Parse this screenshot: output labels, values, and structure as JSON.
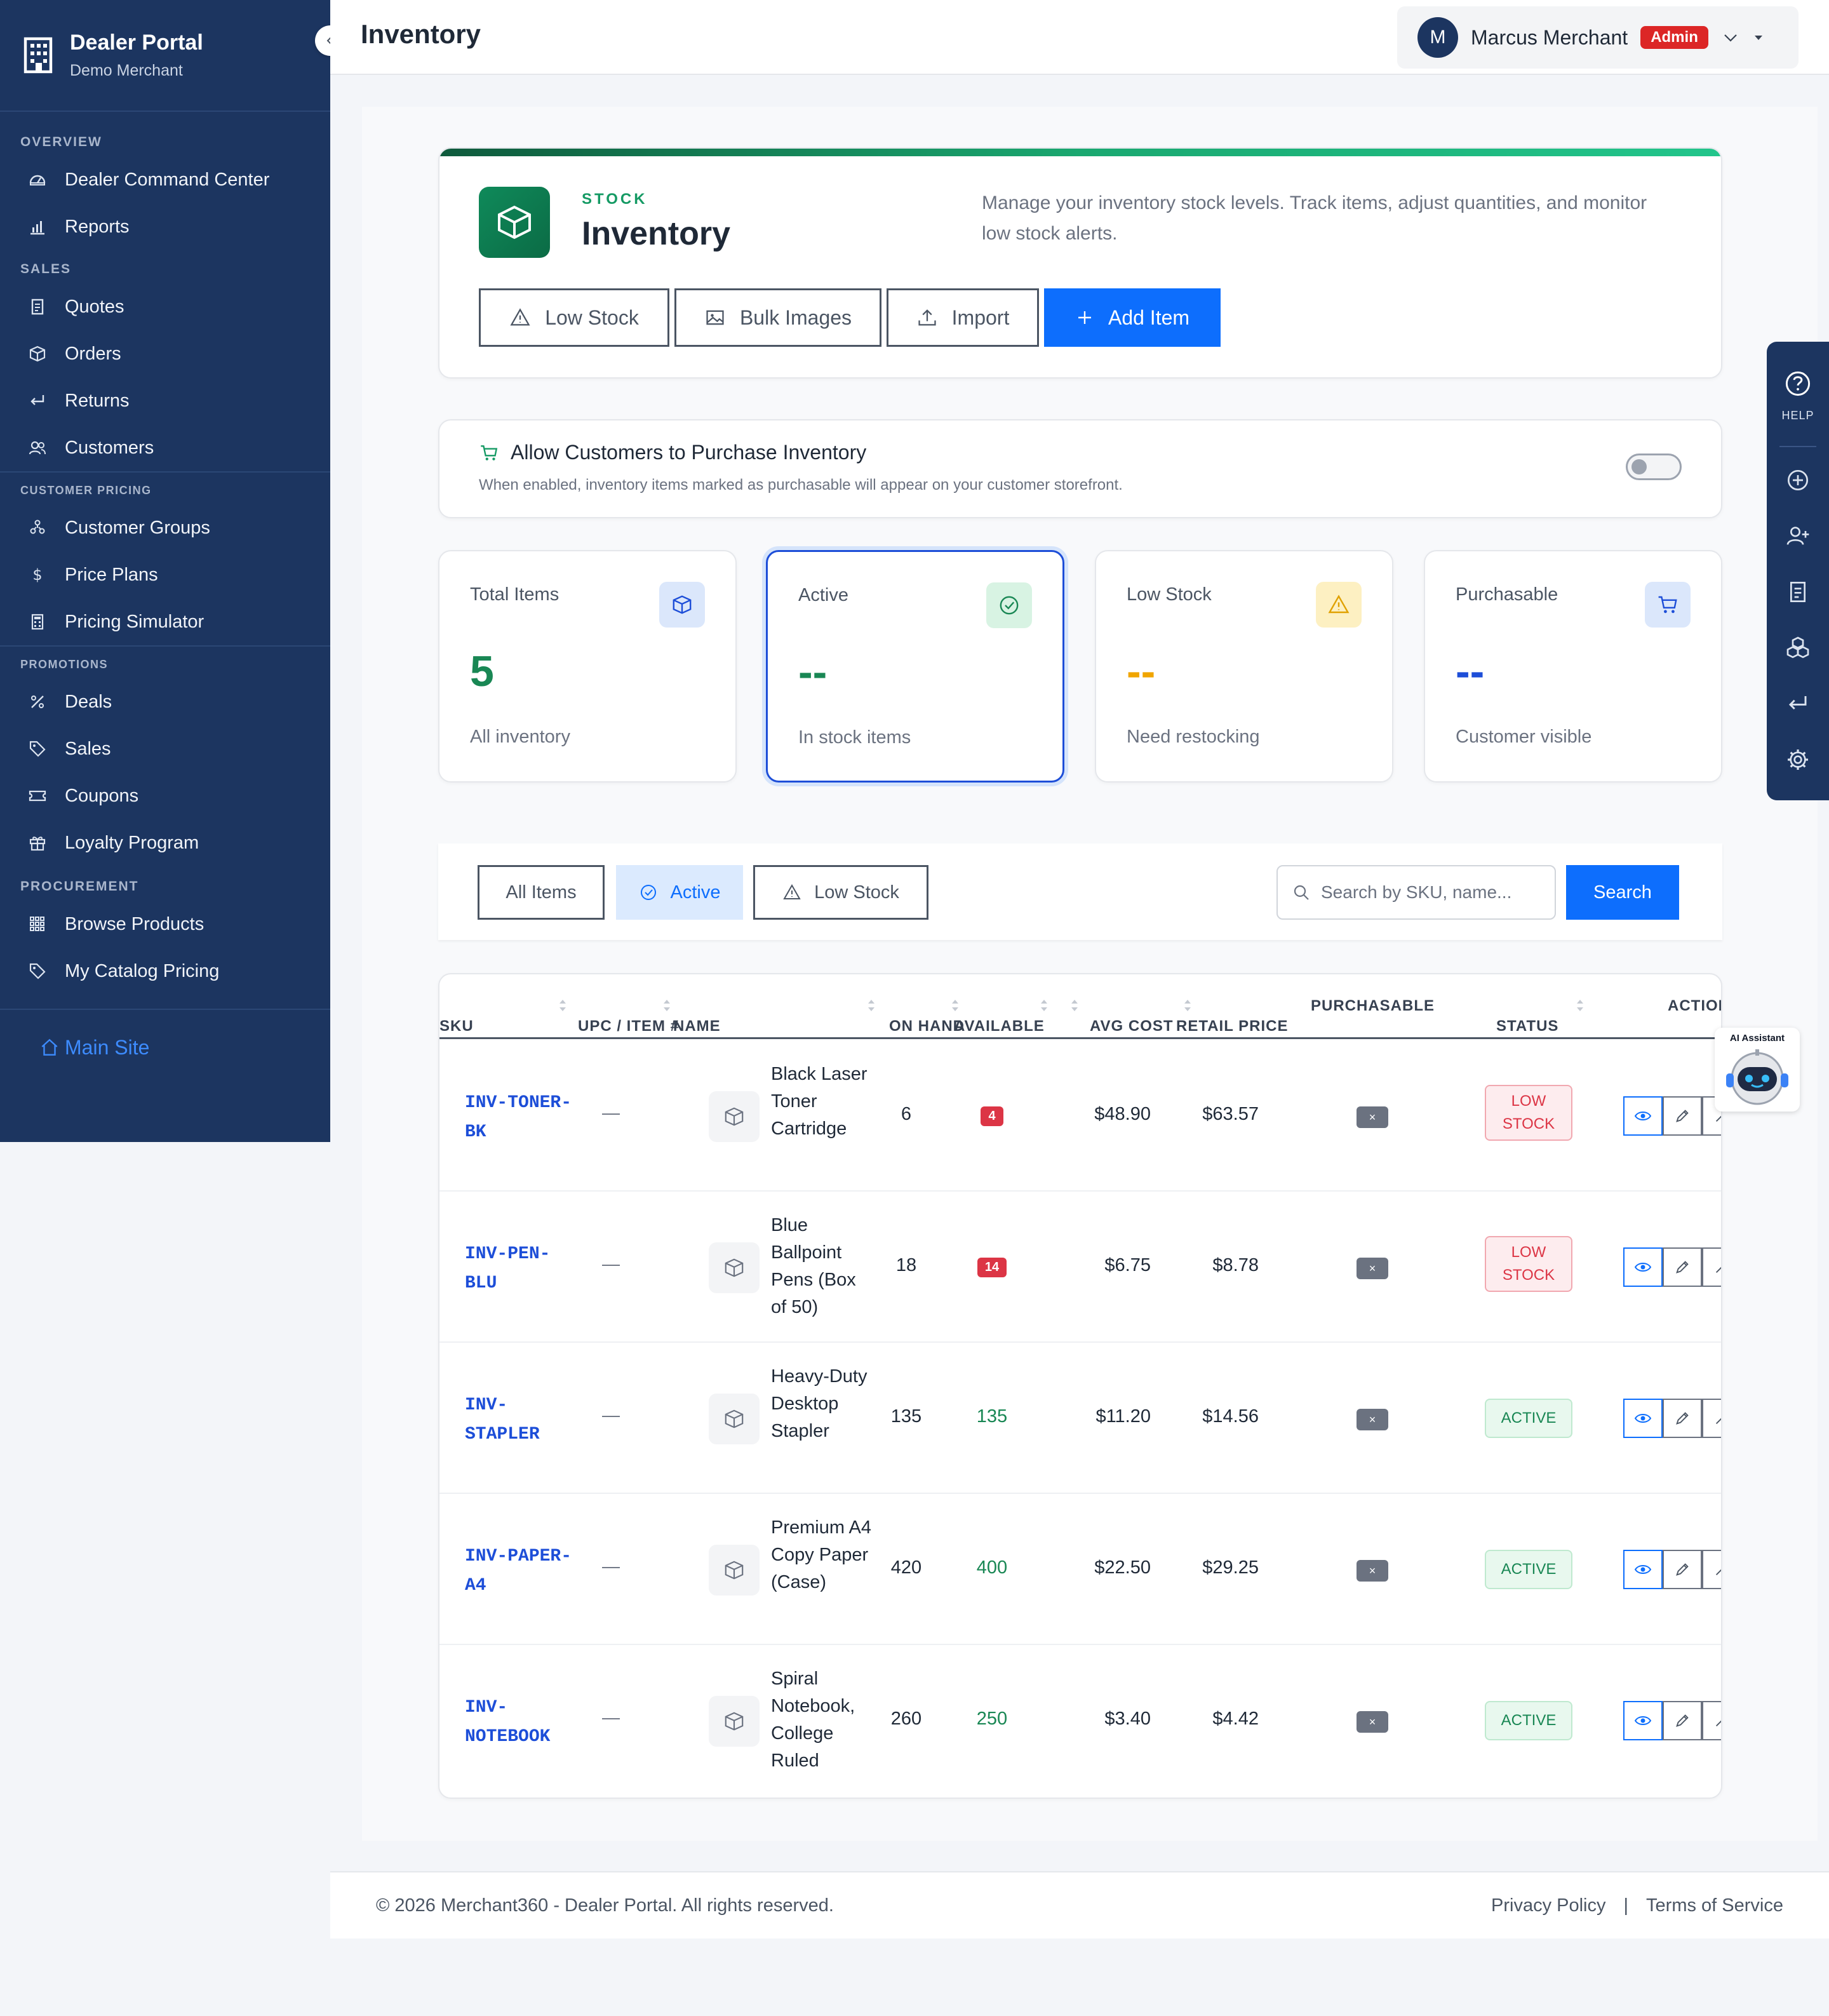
{
  "brand": {
    "title": "Dealer Portal",
    "subtitle": "Demo Merchant"
  },
  "nav": {
    "overview_label": "OVERVIEW",
    "dealer_command_center": "Dealer Command Center",
    "reports": "Reports",
    "sales_label": "SALES",
    "quotes": "Quotes",
    "orders": "Orders",
    "returns": "Returns",
    "customers": "Customers",
    "customer_pricing_label": "CUSTOMER PRICING",
    "customer_groups": "Customer Groups",
    "price_plans": "Price Plans",
    "pricing_simulator": "Pricing Simulator",
    "promotions_label": "PROMOTIONS",
    "deals": "Deals",
    "sales": "Sales",
    "coupons": "Coupons",
    "loyalty_program": "Loyalty Program",
    "procurement_label": "PROCUREMENT",
    "browse_products": "Browse Products",
    "my_catalog_pricing": "My Catalog Pricing",
    "main_site": "Main Site"
  },
  "topbar": {
    "title": "Inventory",
    "user_initial": "M",
    "user_name": "Marcus Merchant",
    "role_badge": "Admin"
  },
  "header": {
    "eyebrow": "STOCK",
    "title": "Inventory",
    "description": "Manage your inventory stock levels. Track items, adjust quantities, and monitor low stock alerts.",
    "buttons": {
      "low_stock": "Low Stock",
      "bulk_images": "Bulk Images",
      "import": "Import",
      "add_item": "Add Item"
    }
  },
  "purchase_toggle": {
    "title": "Allow Customers to Purchase Inventory",
    "subtitle": "When enabled, inventory items marked as purchasable will appear on your customer storefront.",
    "enabled": false
  },
  "stats": [
    {
      "label": "Total Items",
      "value": "5",
      "sub": "All inventory",
      "color": "#198754"
    },
    {
      "label": "Active",
      "value": "--",
      "sub": "In stock items",
      "color": "#198754"
    },
    {
      "label": "Low Stock",
      "value": "--",
      "sub": "Need restocking",
      "color": "#f0a500"
    },
    {
      "label": "Purchasable",
      "value": "--",
      "sub": "Customer visible",
      "color": "#1d4ed8"
    }
  ],
  "filters": {
    "all_items": "All Items",
    "active": "Active",
    "low_stock": "Low Stock",
    "search_placeholder": "Search by SKU, name...",
    "search_button": "Search",
    "selected": "Active"
  },
  "table": {
    "headers": {
      "sku": "SKU",
      "upc": "UPC / ITEM #",
      "name": "NAME",
      "on_hand": "ON HAND",
      "available": "AVAILABLE",
      "avg_cost": "AVG COST",
      "retail_price": "RETAIL PRICE",
      "purchasable": "PURCHASABLE",
      "status": "STATUS",
      "actions": "ACTIONS"
    },
    "rows": [
      {
        "sku": "INV-TONER-BK",
        "upc": "—",
        "name": "Black Laser Toner Cartridge",
        "on_hand": "6",
        "available": "4",
        "available_low": true,
        "avg_cost": "$48.90",
        "retail": "$63.57",
        "purchasable": "×",
        "status": "LOW STOCK"
      },
      {
        "sku": "INV-PEN-BLU",
        "upc": "—",
        "name": "Blue Ballpoint Pens (Box of 50)",
        "on_hand": "18",
        "available": "14",
        "available_low": true,
        "avg_cost": "$6.75",
        "retail": "$8.78",
        "purchasable": "×",
        "status": "LOW STOCK"
      },
      {
        "sku": "INV-STAPLER",
        "upc": "—",
        "name": "Heavy-Duty Desktop Stapler",
        "on_hand": "135",
        "available": "135",
        "available_low": false,
        "avg_cost": "$11.20",
        "retail": "$14.56",
        "purchasable": "×",
        "status": "ACTIVE"
      },
      {
        "sku": "INV-PAPER-A4",
        "upc": "—",
        "name": "Premium A4 Copy Paper (Case)",
        "on_hand": "420",
        "available": "400",
        "available_low": false,
        "avg_cost": "$22.50",
        "retail": "$29.25",
        "purchasable": "×",
        "status": "ACTIVE"
      },
      {
        "sku": "INV-NOTEBOOK",
        "upc": "—",
        "name": "Spiral Notebook, College Ruled",
        "on_hand": "260",
        "available": "250",
        "available_low": false,
        "avg_cost": "$3.40",
        "retail": "$4.42",
        "purchasable": "×",
        "status": "ACTIVE"
      }
    ]
  },
  "rail": {
    "help": "HELP"
  },
  "ai_assistant": {
    "label": "AI Assistant"
  },
  "footer": {
    "copyright": "© 2026 Merchant360 - Dealer Portal. All rights reserved.",
    "privacy": "Privacy Policy",
    "terms": "Terms of Service"
  }
}
